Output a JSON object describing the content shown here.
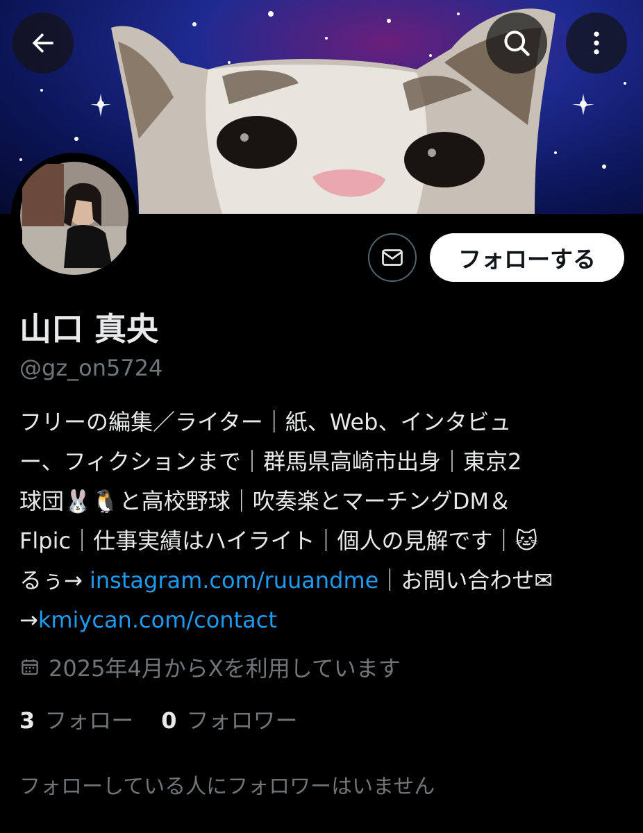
{
  "profile": {
    "display_name": "山口 真央",
    "handle": "@gz_on5724",
    "follow_label": "フォローする",
    "bio_lines": [
      {
        "a": "フリーの編集／ライター｜紙、Web、インタビュ"
      },
      {
        "a": "ー、フィクションまで｜群馬県高崎市出身｜東京2"
      },
      {
        "a": "球団🐰🐧と高校野球｜吹奏楽とマーチングDM＆"
      },
      {
        "a": "Flpic｜仕事実績はハイライト｜個人の見解です｜🐱"
      },
      {
        "a": "るぅ→ ",
        "link": "instagram.com/ruuandme",
        "b": "｜お問い合わせ✉"
      },
      {
        "a": "→",
        "link": "kmiycan.com/contact"
      }
    ],
    "joined": "2025年4月からXを利用しています",
    "following_count": "3",
    "following_label": "フォロー",
    "followers_count": "0",
    "followers_label": "フォロワー",
    "no_followers_text": "フォローしている人にフォロワーはいません"
  },
  "icons": {
    "back": "back-arrow-icon",
    "search": "search-icon",
    "more": "more-vertical-icon",
    "message": "envelope-icon",
    "calendar": "calendar-icon"
  },
  "colors": {
    "background": "#000000",
    "link": "#1d9bf0",
    "secondary_text": "#71767b",
    "follow_button_bg": "#ffffff"
  }
}
